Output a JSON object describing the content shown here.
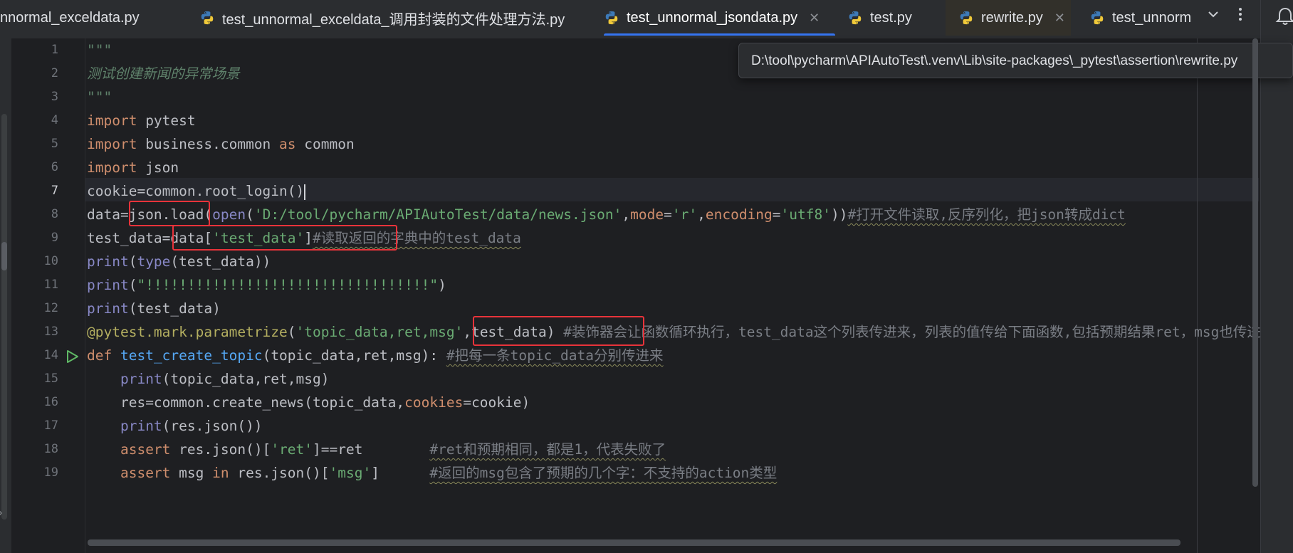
{
  "tabs": [
    {
      "label": "nnormal_exceldata.py",
      "closable": false,
      "active": false,
      "icon": "python-icon"
    },
    {
      "label": "test_unnormal_exceldata_调用封装的文件处理方法.py",
      "closable": false,
      "active": false,
      "icon": "python-icon"
    },
    {
      "label": "test_unnormal_jsondata.py",
      "closable": true,
      "active": true,
      "icon": "python-icon"
    },
    {
      "label": "test.py",
      "closable": false,
      "active": false,
      "icon": "python-icon"
    },
    {
      "label": "rewrite.py",
      "closable": true,
      "active": false,
      "icon": "python-icon"
    },
    {
      "label": "test_unnorm",
      "closable": false,
      "active": false,
      "icon": "python-icon"
    }
  ],
  "tab_close_glyph": "✕",
  "tooltip_path": "D:\\tool\\pycharm\\APIAutoTest\\.venv\\Lib\\site-packages\\_pytest\\assertion\\rewrite.py",
  "line_numbers": [
    "1",
    "2",
    "3",
    "4",
    "5",
    "6",
    "7",
    "8",
    "9",
    "10",
    "11",
    "12",
    "13",
    "14",
    "15",
    "16",
    "17",
    "18",
    "19"
  ],
  "current_line": "7",
  "code": {
    "l1": "\"\"\"",
    "l2": "测试创建新闻的异常场景",
    "l3": "\"\"\"",
    "kw_import": "import",
    "l4_mod": " pytest",
    "l5_mod": " business.common ",
    "kw_as": "as",
    "l5_alias": " common",
    "l6_mod": " json",
    "l7": "cookie=common.root_login()",
    "l8_a": "data=",
    "l8_b": "json.load",
    "l8_c": "(",
    "l8_open": "open",
    "l8_d": "(",
    "l8_str1": "'D:/tool/pycharm/APIAutoTest/data/news.json'",
    "comma": ",",
    "l8_mode": "mode",
    "eq": "=",
    "l8_r": "'r'",
    "l8_enc": "encoding",
    "l8_utf": "'utf8'",
    "l8_close": "))",
    "l8_cm": "#打开文件读取,反序列化，把json转成dict",
    "l9_a": "test_data=data[",
    "l9_str": "'test_data'",
    "l9_b": "]",
    "l9_cm": "#读取返回的字典中的test_data",
    "print": "print",
    "type": "type",
    "l10_rest": "(test_data))",
    "l10_open": "(",
    "l11_open": "(",
    "l11_str": "\"!!!!!!!!!!!!!!!!!!!!!!!!!!!!!!!!!!\"",
    "l11_close": ")",
    "l12_rest": "(test_data)",
    "l13_dec": "@pytest.mark.parametrize",
    "l13_open": "(",
    "l13_str": "'topic_data,ret,msg'",
    "l13_arg": "test_data",
    "l13_close": ")",
    "l13_cm": " #装饰器会让函数循环执行，test_data这个列表传进来，列表的值传给下面函数,包括预期结果ret，msg也传进",
    "kw_def": "def",
    "l14_fn": "test_create_topic",
    "l14_params": "(topic_data,ret,msg):",
    "l14_cm": "#把每一条topic_data分别传进来",
    "indent": "    ",
    "l15_rest": "(topic_data,ret,msg)",
    "l16_a": "res=common.create_news(topic_data,",
    "l16_kw": "cookies",
    "l16_b": "=cookie)",
    "l17_rest": "(res.json())",
    "kw_assert": "assert",
    "l18_a": " res.json()[",
    "l18_str": "'ret'",
    "l18_b": "]==ret        ",
    "l18_cm": "#ret和预期相同，都是1，代表失败了",
    "l19_a": " msg ",
    "kw_in": "in",
    "l19_b": " res.json()[",
    "l19_str": "'msg'",
    "l19_c": "]      ",
    "l19_cm": "#返回的msg包含了预期的几个字：不支持的action类型"
  },
  "colors": {
    "background": "#1e1f22",
    "keyword": "#cf8e6d",
    "string": "#6aab73",
    "comment": "#7a7e85",
    "function": "#56a8f5",
    "builtin": "#8888c6",
    "decorator": "#b3ae60",
    "annotation_box": "#e8333a",
    "active_tab_underline": "#3574f0"
  }
}
